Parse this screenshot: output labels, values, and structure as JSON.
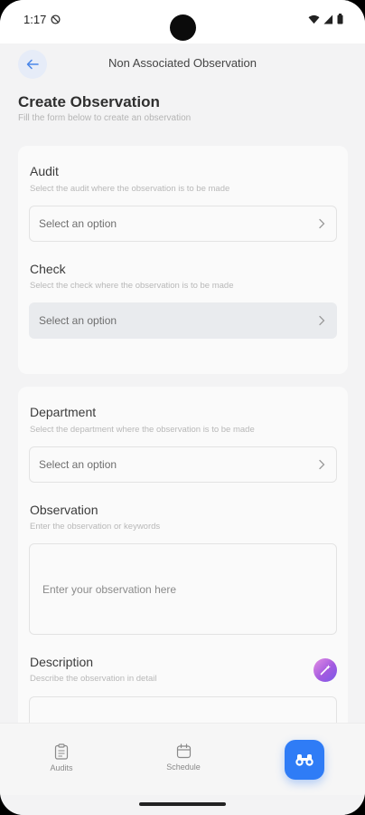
{
  "status_bar": {
    "time": "1:17",
    "icons": [
      "do-not-disturb-icon",
      "wifi-icon",
      "signal-icon",
      "battery-icon"
    ]
  },
  "header": {
    "title": "Non Associated Observation",
    "back_icon": "arrow-left-icon"
  },
  "page": {
    "title": "Create Observation",
    "subtitle": "Fill the form below to create an observation"
  },
  "form": {
    "audit": {
      "label": "Audit",
      "hint": "Select the audit where the observation is to be made",
      "value": "Select an option"
    },
    "check": {
      "label": "Check",
      "hint": "Select the check where the observation is to be made",
      "value": "Select an option",
      "disabled": true
    },
    "department": {
      "label": "Department",
      "hint": "Select the department where the observation is to be made",
      "value": "Select an option"
    },
    "observation": {
      "label": "Observation",
      "hint": "Enter the observation or keywords",
      "placeholder": "Enter your observation here"
    },
    "description": {
      "label": "Description",
      "hint": "Describe the observation in detail",
      "ai_icon": "magic-wand-icon"
    }
  },
  "bottom_nav": {
    "items": [
      {
        "label": "Audits",
        "icon": "clipboard-icon"
      },
      {
        "label": "Schedule",
        "icon": "calendar-icon"
      }
    ],
    "fab_icon": "binoculars-icon"
  },
  "colors": {
    "accent": "#2f7cf6",
    "background": "#f3f3f4",
    "card": "#fafafa",
    "disabled_field": "#e9ebee"
  }
}
